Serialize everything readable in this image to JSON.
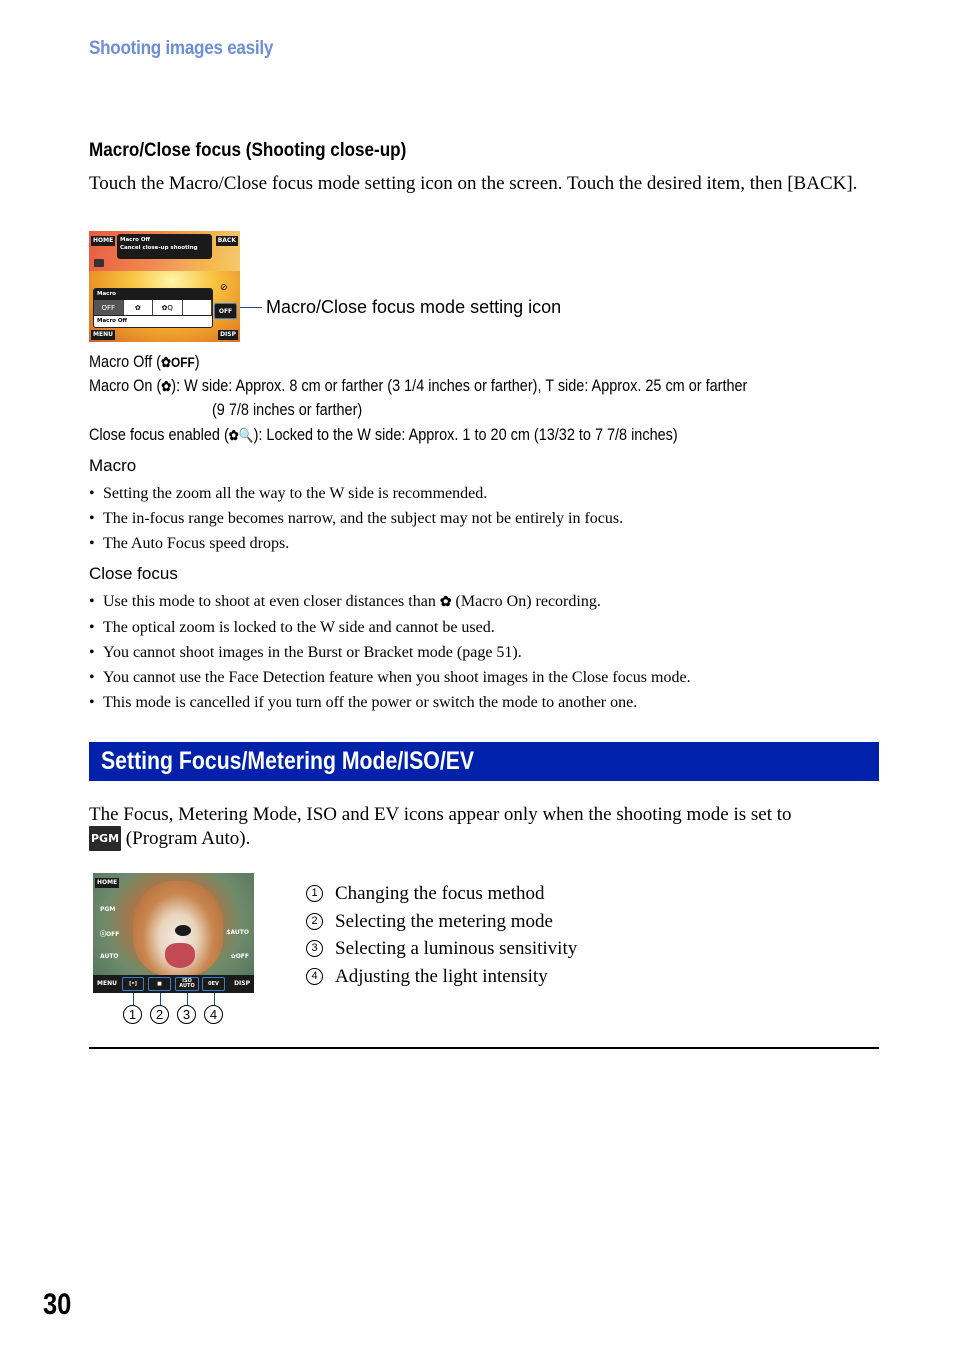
{
  "header": {
    "section_label": "Shooting images easily"
  },
  "macro_section": {
    "heading": "Macro/Close focus (Shooting close-up)",
    "intro": "Touch the Macro/Close focus mode setting icon on the screen. Touch the desired item, then [BACK].",
    "screen": {
      "home": "HOME",
      "back": "BACK",
      "menu": "MENU",
      "disp": "DISP",
      "tip_line1": "Macro Off",
      "tip_line2": "Cancel close-up shooting",
      "panel_title": "Macro",
      "options": [
        "OFF",
        "✿",
        "✿Q",
        ""
      ],
      "current": "Macro Off",
      "macro_icon": "OFF"
    },
    "callout": "Macro/Close focus mode setting icon",
    "definitions": [
      {
        "label": "Macro Off (",
        "icon": "macro-off-icon",
        "icon_text": "✿OFF",
        "tail": ")",
        "desc": ""
      },
      {
        "label": "Macro On (",
        "icon": "macro-on-icon",
        "icon_text": "✿",
        "tail": "):",
        "desc": "W side: Approx. 8 cm or farther (3 1/4 inches or farther), T side: Approx. 25 cm or farther",
        "desc2": "(9 7/8 inches or farther)"
      },
      {
        "label": "Close focus enabled (",
        "icon": "close-focus-icon",
        "icon_text": "✿🔍",
        "tail": "):",
        "desc": "Locked to the W side: Approx. 1 to 20 cm (13/32 to 7 7/8 inches)"
      }
    ],
    "macro_notes": {
      "title": "Macro",
      "items": [
        "Setting the zoom all the way to the W side is recommended.",
        "The in-focus range becomes narrow, and the subject may not be entirely in focus.",
        "The Auto Focus speed drops."
      ]
    },
    "close_focus_notes": {
      "title": "Close focus",
      "item0_before": "Use this mode to shoot at even closer distances than",
      "item0_icon": "✿",
      "item0_after": "(Macro On) recording.",
      "items": [
        "The optical zoom is locked to the W side and cannot be used.",
        "You cannot shoot images in the Burst or Bracket mode (page 51).",
        "You cannot use the Face Detection feature when you shoot images in the Close focus mode.",
        "This mode is cancelled if you turn off the power or switch the mode to another one."
      ]
    }
  },
  "focus_section": {
    "banner_title": "Setting Focus/Metering Mode/ISO/EV",
    "banner_color": "#0022aa",
    "para_line1": "The Focus, Metering Mode, ISO and EV icons appear only when the shooting mode is set to",
    "pgm_badge": "PGM",
    "para_line2": "(Program Auto).",
    "screen": {
      "home": "HOME",
      "menu": "MENU",
      "disp": "DISP",
      "buttons": [
        "[•]",
        "■",
        "ISO AUTO",
        "0EV"
      ],
      "left_icons": [
        "PGM",
        "ⓢOFF",
        "AUTO"
      ],
      "right_icons": [
        "$AUTO",
        "✿OFF"
      ]
    },
    "callout_numbers": [
      "1",
      "2",
      "3",
      "4"
    ],
    "features": [
      {
        "num": "1",
        "text": "Changing the focus method"
      },
      {
        "num": "2",
        "text": "Selecting the metering mode"
      },
      {
        "num": "3",
        "text": "Selecting a luminous sensitivity"
      },
      {
        "num": "4",
        "text": "Adjusting the light intensity"
      }
    ]
  },
  "footer": {
    "page_number": "30"
  }
}
